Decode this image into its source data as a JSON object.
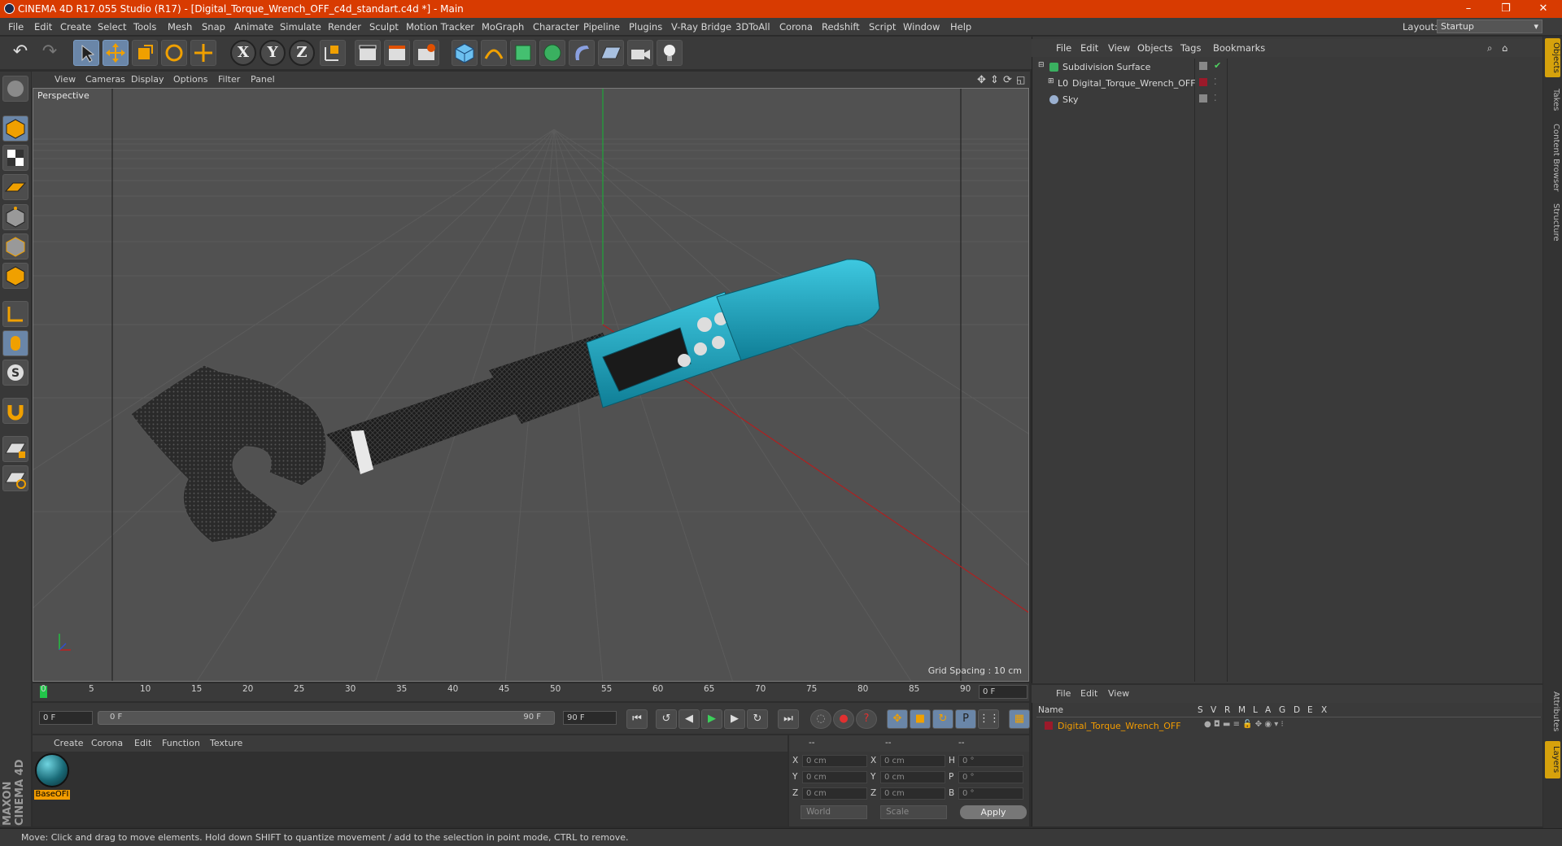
{
  "window": {
    "title": "CINEMA 4D R17.055 Studio (R17) - [Digital_Torque_Wrench_OFF_c4d_standart.c4d *] - Main",
    "controls": [
      "–",
      "❒",
      "✕"
    ]
  },
  "menubar": {
    "items": [
      "File",
      "Edit",
      "Create",
      "Select",
      "Tools",
      "Mesh",
      "Snap",
      "Animate",
      "Simulate",
      "Render",
      "Sculpt",
      "Motion Tracker",
      "MoGraph",
      "Character",
      "Pipeline",
      "Plugins",
      "V-Ray Bridge",
      "3DToAll",
      "Corona",
      "Redshift",
      "Script",
      "Window",
      "Help"
    ],
    "layout_label": "Layout:",
    "layout_value": "Startup"
  },
  "toolbar": {
    "axis_x": "X",
    "axis_y": "Y",
    "axis_z": "Z"
  },
  "viewport": {
    "menu": [
      "View",
      "Cameras",
      "Display",
      "Options",
      "Filter",
      "Panel"
    ],
    "camera_label": "Perspective",
    "grid_spacing": "Grid Spacing : 10 cm"
  },
  "timeline": {
    "ticks": [
      "0",
      "5",
      "10",
      "15",
      "20",
      "25",
      "30",
      "35",
      "40",
      "45",
      "50",
      "55",
      "60",
      "65",
      "70",
      "75",
      "80",
      "85",
      "90"
    ],
    "current_frame": "0 F",
    "start_frame": "0 F",
    "range_start": "0 F",
    "range_end": "90 F",
    "end_frame": "90 F"
  },
  "material_manager": {
    "menu": [
      "Create",
      "Corona",
      "Edit",
      "Function",
      "Texture"
    ],
    "material_name": "BaseOFI"
  },
  "coordinates": {
    "header": [
      "--",
      "--",
      "--"
    ],
    "rows": [
      {
        "l1": "X",
        "v1": "0 cm",
        "l2": "X",
        "v2": "0 cm",
        "l3": "H",
        "v3": "0 °"
      },
      {
        "l1": "Y",
        "v1": "0 cm",
        "l2": "Y",
        "v2": "0 cm",
        "l3": "P",
        "v3": "0 °"
      },
      {
        "l1": "Z",
        "v1": "0 cm",
        "l2": "Z",
        "v2": "0 cm",
        "l3": "B",
        "v3": "0 °"
      }
    ],
    "mode_world": "World",
    "mode_scale": "Scale",
    "apply": "Apply"
  },
  "object_manager": {
    "menu": [
      "File",
      "Edit",
      "View",
      "Objects",
      "Tags",
      "Bookmarks"
    ],
    "objects": [
      {
        "name": "Subdivision Surface",
        "indent": 0
      },
      {
        "name": "Digital_Torque_Wrench_OFF",
        "indent": 1
      },
      {
        "name": "Sky",
        "indent": 0
      }
    ]
  },
  "layer_manager": {
    "menu": [
      "File",
      "Edit",
      "View"
    ],
    "columns": [
      "Name",
      "S",
      "V",
      "R",
      "M",
      "L",
      "A",
      "G",
      "D",
      "E",
      "X"
    ],
    "layer_name": "Digital_Torque_Wrench_OFF",
    "layer_color": "#9b1a2a"
  },
  "right_tabs": [
    "Objects",
    "Takes",
    "Content Browser",
    "Structure",
    "Attributes",
    "Layers"
  ],
  "status": {
    "text": "Move: Click and drag to move elements. Hold down SHIFT to quantize movement / add to the selection in point mode, CTRL to remove."
  },
  "branding": "MAXON CINEMA 4D",
  "colors": {
    "accent": "#d83b01",
    "wrench_teal": "#1aa5c4",
    "selection_orange": "#f39c00"
  }
}
